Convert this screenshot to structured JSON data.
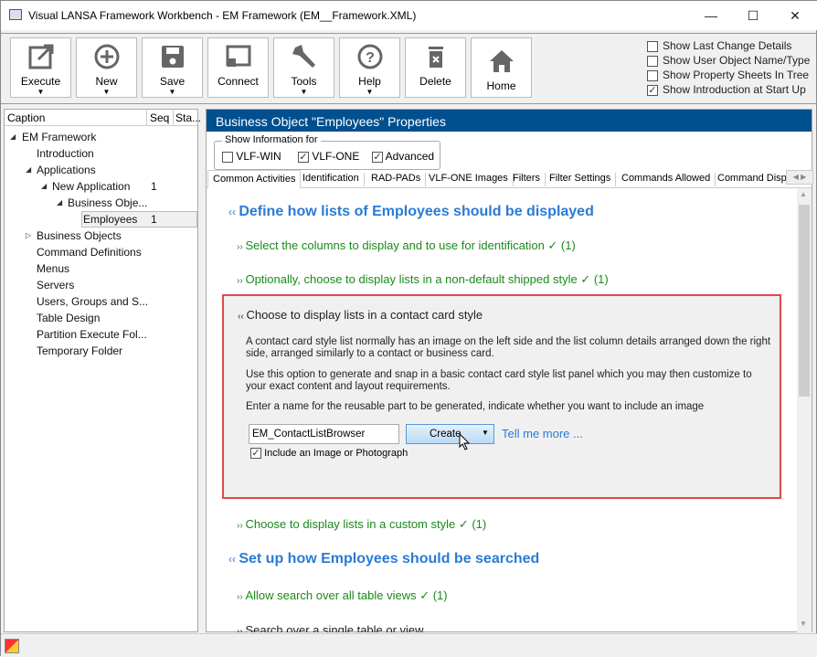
{
  "window": {
    "title": "Visual LANSA Framework Workbench - EM Framework (EM__Framework.XML)",
    "minimize": "—",
    "maximize": "☐",
    "close": "✕"
  },
  "toolbar": [
    {
      "label": "Execute",
      "icon": "external-link-icon",
      "dropdown": true
    },
    {
      "label": "New",
      "icon": "plus-circle-icon",
      "dropdown": true
    },
    {
      "label": "Save",
      "icon": "floppy-disk-icon",
      "dropdown": true
    },
    {
      "label": "Connect",
      "icon": "cast-icon",
      "dropdown": false
    },
    {
      "label": "Tools",
      "icon": "wrench-icon",
      "dropdown": true
    },
    {
      "label": "Help",
      "icon": "question-icon",
      "dropdown": true
    },
    {
      "label": "Delete",
      "icon": "trash-icon",
      "dropdown": false
    },
    {
      "label": "Home",
      "icon": "home-icon",
      "dropdown": false
    }
  ],
  "options": [
    {
      "label": "Show Last Change Details",
      "checked": false
    },
    {
      "label": "Show User Object Name/Type",
      "checked": false
    },
    {
      "label": "Show Property Sheets In Tree",
      "checked": false
    },
    {
      "label": "Show Introduction at Start Up",
      "checked": true
    }
  ],
  "tree": {
    "columns": [
      "Caption",
      "Seq",
      "Sta..."
    ],
    "items": [
      {
        "label": "EM Framework",
        "level": 0,
        "toggle": "expanded",
        "seq": ""
      },
      {
        "label": "Introduction",
        "level": 1,
        "toggle": "",
        "seq": ""
      },
      {
        "label": "Applications",
        "level": 1,
        "toggle": "expanded",
        "seq": ""
      },
      {
        "label": "New Application",
        "level": 2,
        "toggle": "expanded",
        "seq": "1"
      },
      {
        "label": "Business Obje...",
        "level": 3,
        "toggle": "expanded",
        "seq": ""
      },
      {
        "label": "Employees",
        "level": 4,
        "toggle": "",
        "seq": "1",
        "selected": true
      },
      {
        "label": "Business Objects",
        "level": 1,
        "toggle": "collapsed",
        "seq": ""
      },
      {
        "label": "Command Definitions",
        "level": 1,
        "toggle": "",
        "seq": ""
      },
      {
        "label": "Menus",
        "level": 1,
        "toggle": "",
        "seq": ""
      },
      {
        "label": "Servers",
        "level": 1,
        "toggle": "",
        "seq": ""
      },
      {
        "label": "Users, Groups and S...",
        "level": 1,
        "toggle": "",
        "seq": ""
      },
      {
        "label": "Table Design",
        "level": 1,
        "toggle": "",
        "seq": ""
      },
      {
        "label": "Partition Execute Fol...",
        "level": 1,
        "toggle": "",
        "seq": ""
      },
      {
        "label": "Temporary Folder",
        "level": 1,
        "toggle": "",
        "seq": ""
      }
    ]
  },
  "panel": {
    "title": "Business Object \"Employees\" Properties",
    "show_info": {
      "legend": "Show Information for",
      "options": [
        {
          "label": "VLF-WIN",
          "checked": false
        },
        {
          "label": "VLF-ONE",
          "checked": true
        },
        {
          "label": "Advanced",
          "checked": true
        }
      ]
    },
    "tabs": [
      "Common Activities",
      "Identification",
      "RAD-PADs",
      "VLF-ONE Images",
      "Filters",
      "Filter Settings",
      "Commands Allowed",
      "Command Displa"
    ],
    "active_tab": 0,
    "content": {
      "heading1": "Define how lists of Employees should be displayed",
      "item1": "Select the columns to display and to use for identification  ✓ (1)",
      "item2": "Optionally, choose to display lists in a non-default shipped style  ✓ (1)",
      "card": {
        "title": "Choose to display lists in a contact card style",
        "p1": "A contact card style list normally has an image on the left side and the list column details arranged down the right side, arranged similarly to a contact or business card.",
        "p2": "Use this option to generate and snap in a basic contact card style list panel which you may then customize to your exact content and layout requirements.",
        "p3": "Enter a name for the reusable part to be generated, indicate whether you want to include an image",
        "name_value": "EM_ContactListBrowser",
        "create_label": "Create",
        "tell_more": "Tell me more ...",
        "include_image_label": "Include an Image or Photograph",
        "include_image_checked": true
      },
      "item3": "Choose to display lists in a custom style  ✓ (1)",
      "heading2": "Set up how Employees should be searched",
      "item4": "Allow search over all table views  ✓ (1)",
      "item5": "Search over a single table or view"
    }
  },
  "colors": {
    "header_blue": "#004f8f",
    "link_blue": "#2a7bd4",
    "done_green": "#1a8a1a",
    "highlight_red": "#e04848"
  }
}
